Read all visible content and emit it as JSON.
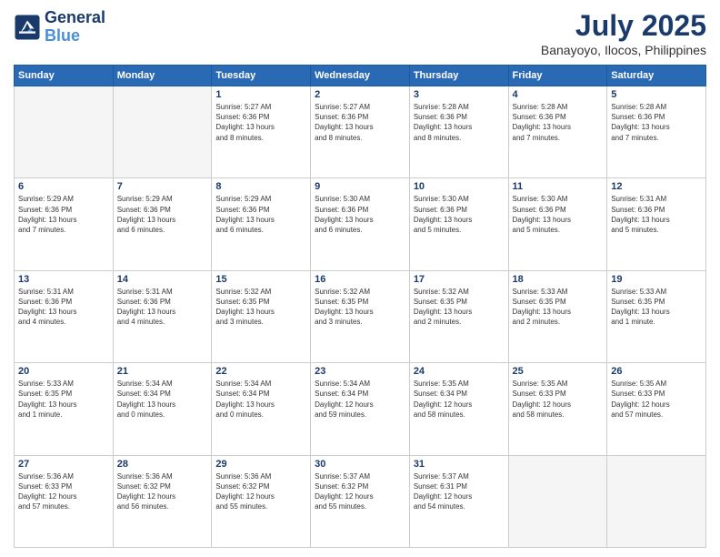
{
  "logo": {
    "line1": "General",
    "line2": "Blue"
  },
  "title": "July 2025",
  "subtitle": "Banayoyo, Ilocos, Philippines",
  "days_header": [
    "Sunday",
    "Monday",
    "Tuesday",
    "Wednesday",
    "Thursday",
    "Friday",
    "Saturday"
  ],
  "weeks": [
    [
      {
        "num": "",
        "info": ""
      },
      {
        "num": "",
        "info": ""
      },
      {
        "num": "1",
        "info": "Sunrise: 5:27 AM\nSunset: 6:36 PM\nDaylight: 13 hours\nand 8 minutes."
      },
      {
        "num": "2",
        "info": "Sunrise: 5:27 AM\nSunset: 6:36 PM\nDaylight: 13 hours\nand 8 minutes."
      },
      {
        "num": "3",
        "info": "Sunrise: 5:28 AM\nSunset: 6:36 PM\nDaylight: 13 hours\nand 8 minutes."
      },
      {
        "num": "4",
        "info": "Sunrise: 5:28 AM\nSunset: 6:36 PM\nDaylight: 13 hours\nand 7 minutes."
      },
      {
        "num": "5",
        "info": "Sunrise: 5:28 AM\nSunset: 6:36 PM\nDaylight: 13 hours\nand 7 minutes."
      }
    ],
    [
      {
        "num": "6",
        "info": "Sunrise: 5:29 AM\nSunset: 6:36 PM\nDaylight: 13 hours\nand 7 minutes."
      },
      {
        "num": "7",
        "info": "Sunrise: 5:29 AM\nSunset: 6:36 PM\nDaylight: 13 hours\nand 6 minutes."
      },
      {
        "num": "8",
        "info": "Sunrise: 5:29 AM\nSunset: 6:36 PM\nDaylight: 13 hours\nand 6 minutes."
      },
      {
        "num": "9",
        "info": "Sunrise: 5:30 AM\nSunset: 6:36 PM\nDaylight: 13 hours\nand 6 minutes."
      },
      {
        "num": "10",
        "info": "Sunrise: 5:30 AM\nSunset: 6:36 PM\nDaylight: 13 hours\nand 5 minutes."
      },
      {
        "num": "11",
        "info": "Sunrise: 5:30 AM\nSunset: 6:36 PM\nDaylight: 13 hours\nand 5 minutes."
      },
      {
        "num": "12",
        "info": "Sunrise: 5:31 AM\nSunset: 6:36 PM\nDaylight: 13 hours\nand 5 minutes."
      }
    ],
    [
      {
        "num": "13",
        "info": "Sunrise: 5:31 AM\nSunset: 6:36 PM\nDaylight: 13 hours\nand 4 minutes."
      },
      {
        "num": "14",
        "info": "Sunrise: 5:31 AM\nSunset: 6:36 PM\nDaylight: 13 hours\nand 4 minutes."
      },
      {
        "num": "15",
        "info": "Sunrise: 5:32 AM\nSunset: 6:35 PM\nDaylight: 13 hours\nand 3 minutes."
      },
      {
        "num": "16",
        "info": "Sunrise: 5:32 AM\nSunset: 6:35 PM\nDaylight: 13 hours\nand 3 minutes."
      },
      {
        "num": "17",
        "info": "Sunrise: 5:32 AM\nSunset: 6:35 PM\nDaylight: 13 hours\nand 2 minutes."
      },
      {
        "num": "18",
        "info": "Sunrise: 5:33 AM\nSunset: 6:35 PM\nDaylight: 13 hours\nand 2 minutes."
      },
      {
        "num": "19",
        "info": "Sunrise: 5:33 AM\nSunset: 6:35 PM\nDaylight: 13 hours\nand 1 minute."
      }
    ],
    [
      {
        "num": "20",
        "info": "Sunrise: 5:33 AM\nSunset: 6:35 PM\nDaylight: 13 hours\nand 1 minute."
      },
      {
        "num": "21",
        "info": "Sunrise: 5:34 AM\nSunset: 6:34 PM\nDaylight: 13 hours\nand 0 minutes."
      },
      {
        "num": "22",
        "info": "Sunrise: 5:34 AM\nSunset: 6:34 PM\nDaylight: 13 hours\nand 0 minutes."
      },
      {
        "num": "23",
        "info": "Sunrise: 5:34 AM\nSunset: 6:34 PM\nDaylight: 12 hours\nand 59 minutes."
      },
      {
        "num": "24",
        "info": "Sunrise: 5:35 AM\nSunset: 6:34 PM\nDaylight: 12 hours\nand 58 minutes."
      },
      {
        "num": "25",
        "info": "Sunrise: 5:35 AM\nSunset: 6:33 PM\nDaylight: 12 hours\nand 58 minutes."
      },
      {
        "num": "26",
        "info": "Sunrise: 5:35 AM\nSunset: 6:33 PM\nDaylight: 12 hours\nand 57 minutes."
      }
    ],
    [
      {
        "num": "27",
        "info": "Sunrise: 5:36 AM\nSunset: 6:33 PM\nDaylight: 12 hours\nand 57 minutes."
      },
      {
        "num": "28",
        "info": "Sunrise: 5:36 AM\nSunset: 6:32 PM\nDaylight: 12 hours\nand 56 minutes."
      },
      {
        "num": "29",
        "info": "Sunrise: 5:36 AM\nSunset: 6:32 PM\nDaylight: 12 hours\nand 55 minutes."
      },
      {
        "num": "30",
        "info": "Sunrise: 5:37 AM\nSunset: 6:32 PM\nDaylight: 12 hours\nand 55 minutes."
      },
      {
        "num": "31",
        "info": "Sunrise: 5:37 AM\nSunset: 6:31 PM\nDaylight: 12 hours\nand 54 minutes."
      },
      {
        "num": "",
        "info": ""
      },
      {
        "num": "",
        "info": ""
      }
    ]
  ]
}
